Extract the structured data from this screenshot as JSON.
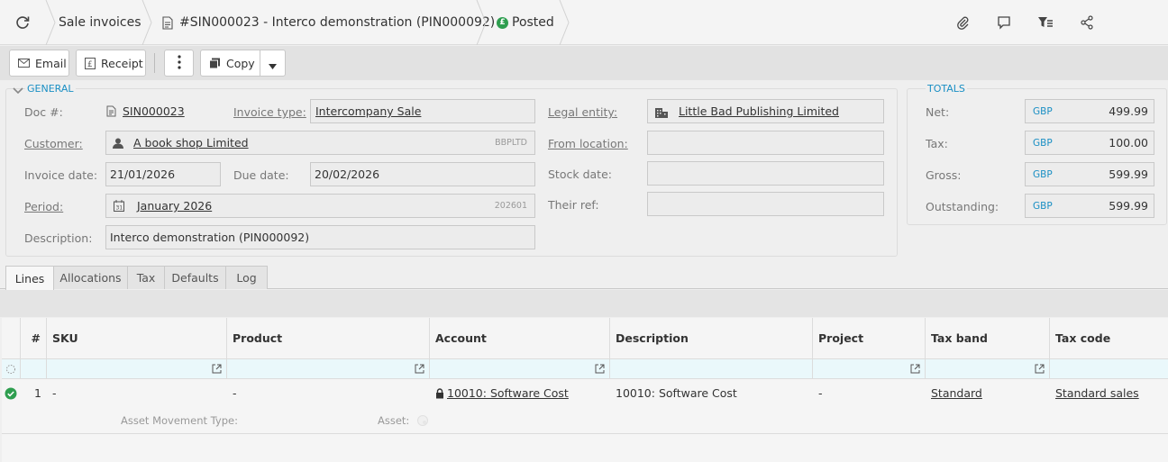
{
  "breadcrumb": {
    "section": "Sale invoices",
    "document": "#SIN000023 - Interco demonstration (PIN000092)",
    "status": "Posted",
    "status_badge": "£"
  },
  "toolbar": {
    "email": "Email",
    "receipt": "Receipt",
    "copy": "Copy"
  },
  "general": {
    "legend": "GENERAL",
    "doc_label": "Doc #:",
    "doc_value": "SIN000023",
    "invoice_type_label": "Invoice type:",
    "invoice_type_value": "Intercompany Sale",
    "legal_entity_label": "Legal entity:",
    "legal_entity_value": "Little Bad Publishing Limited",
    "customer_label": "Customer:",
    "customer_value": "A book shop Limited",
    "customer_code": "BBPLTD",
    "from_location_label": "From location:",
    "invoice_date_label": "Invoice date:",
    "invoice_date_value": "21/01/2026",
    "due_date_label": "Due date:",
    "due_date_value": "20/02/2026",
    "stock_date_label": "Stock date:",
    "period_label": "Period:",
    "period_value": "January 2026",
    "period_code": "202601",
    "period_icon_day": "31",
    "their_ref_label": "Their ref:",
    "description_label": "Description:",
    "description_value": "Interco demonstration (PIN000092)"
  },
  "totals": {
    "legend": "TOTALS",
    "currency": "GBP",
    "rows": [
      {
        "label": "Net:",
        "value": "499.99"
      },
      {
        "label": "Tax:",
        "value": "100.00"
      },
      {
        "label": "Gross:",
        "value": "599.99"
      },
      {
        "label": "Outstanding:",
        "value": "599.99"
      }
    ]
  },
  "tabs": [
    "Lines",
    "Allocations",
    "Tax",
    "Defaults",
    "Log"
  ],
  "grid": {
    "columns": [
      "#",
      "SKU",
      "Product",
      "Account",
      "Description",
      "Project",
      "Tax band",
      "Tax code"
    ],
    "row": {
      "num": "1",
      "sku": "-",
      "product": "-",
      "account": "10010: Software Cost",
      "description": "10010: Software Cost",
      "project": "-",
      "tax_band": "Standard",
      "tax_code": "Standard sales"
    },
    "sub_asset_movement_type": "Asset Movement Type:",
    "sub_asset": "Asset:"
  },
  "colors": {
    "accent": "#1a8fc4",
    "posted": "#2e9e4f"
  }
}
